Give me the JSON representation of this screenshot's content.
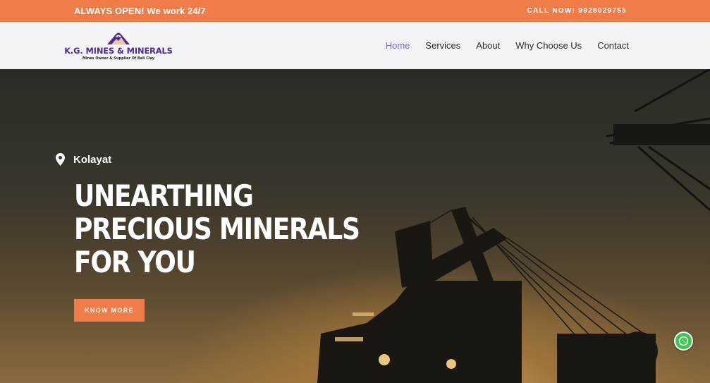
{
  "topbar": {
    "left_text": "ALWAYS OPEN! We work 24/7",
    "right_text": "CALL NOW! 9928029755"
  },
  "logo": {
    "brand": "K.G. MINES & MINERALS",
    "tagline": "Mines Owner & Supplier Of Ball Clay"
  },
  "nav": {
    "items": [
      {
        "label": "Home",
        "active": true
      },
      {
        "label": "Services",
        "active": false
      },
      {
        "label": "About",
        "active": false
      },
      {
        "label": "Why Choose Us",
        "active": false
      },
      {
        "label": "Contact",
        "active": false
      }
    ]
  },
  "hero": {
    "location": "Kolayat",
    "headline": [
      "UNEARTHING",
      "PRECIOUS MINERALS",
      "FOR YOU"
    ],
    "cta_label": "KNOW MORE"
  },
  "icons": {
    "location": "map-pin-icon",
    "chat": "whatsapp-icon"
  },
  "colors": {
    "accent": "#f07c4a",
    "brand": "#4b2d8f",
    "nav_active": "#7b68c9"
  }
}
